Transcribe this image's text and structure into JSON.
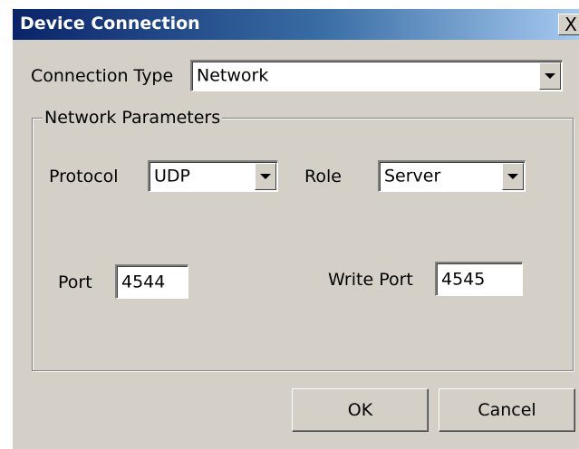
{
  "dialog": {
    "title": "Device Connection",
    "close_label": "X"
  },
  "connection_type": {
    "label": "Connection Type",
    "value": "Network"
  },
  "network_parameters": {
    "group_label": "Network Parameters",
    "protocol": {
      "label": "Protocol",
      "value": "UDP"
    },
    "role": {
      "label": "Role",
      "value": "Server"
    },
    "port": {
      "label": "Port",
      "value": "4544"
    },
    "write_port": {
      "label": "Write Port",
      "value": "4545"
    }
  },
  "buttons": {
    "ok": "OK",
    "cancel": "Cancel"
  },
  "colors": {
    "title_gradient_start": "#0a246a",
    "title_gradient_end": "#a6caf0",
    "face": "#d4d0c8"
  }
}
